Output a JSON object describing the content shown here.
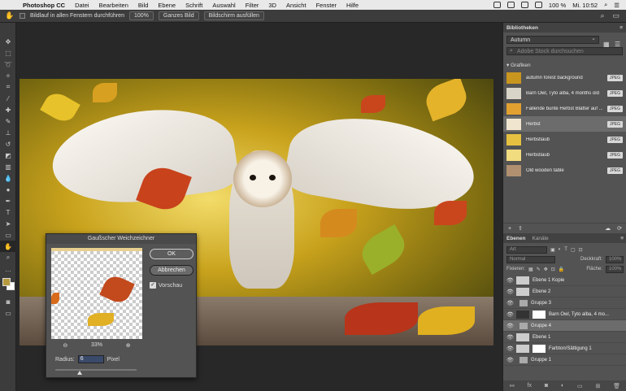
{
  "menubar": {
    "app": "Photoshop CC",
    "items": [
      "Datei",
      "Bearbeiten",
      "Bild",
      "Ebene",
      "Schrift",
      "Auswahl",
      "Filter",
      "3D",
      "Ansicht",
      "Fenster",
      "Hilfe"
    ],
    "battery": "100 %",
    "clock": "Mi. 10:52"
  },
  "options": {
    "scroll_all_label": "Bildlauf in allen Fenstern durchführen",
    "zoom100": "100%",
    "fit_screen": "Ganzes Bild",
    "fill_screen": "Bildschirm ausfüllen"
  },
  "dialog": {
    "title": "Gaußscher Weichzeichner",
    "ok": "OK",
    "cancel": "Abbrechen",
    "preview_label": "Vorschau",
    "zoom": "33%",
    "radius_label": "Radius:",
    "radius_value": "6",
    "radius_unit": "Pixel",
    "radius_fraction": 0.27
  },
  "libraries": {
    "tab": "Bibliotheken",
    "library": "Autumn",
    "search_placeholder": "Adobe Stock durchsuchen",
    "section": "Grafiken",
    "items": [
      {
        "name": "autumn forest background",
        "badge": "JPEG",
        "color": "#c8951e"
      },
      {
        "name": "Barn Owl, Tyto alba, 4 months old",
        "badge": "JPEG",
        "color": "#d9d4c8"
      },
      {
        "name": "Fallende bunte Herbst Blätter auf ...",
        "badge": "JPEG",
        "color": "#e2a030"
      },
      {
        "name": "Herbst",
        "badge": "JPEG",
        "color": "#f0e6d0"
      },
      {
        "name": "Herbstlaub",
        "badge": "JPEG",
        "color": "#e6c040"
      },
      {
        "name": "Herbstlaub",
        "badge": "JPEG",
        "color": "#f2dc80"
      },
      {
        "name": "Old wooden table",
        "badge": "JPEG",
        "color": "#b09070"
      }
    ]
  },
  "layers_panel": {
    "tab_layers": "Ebenen",
    "tab_channels": "Kanäle",
    "kind": "Art",
    "blend_mode": "Normal",
    "opacity_label": "Deckkraft:",
    "opacity_value": "100%",
    "lock_label": "Fixieren:",
    "fill_label": "Fläche:",
    "fill_value": "100%",
    "layers": [
      {
        "name": "Ebene 1 Kopie",
        "type": "layer"
      },
      {
        "name": "Ebene 2",
        "type": "layer"
      },
      {
        "name": "Gruppe 3",
        "type": "group"
      },
      {
        "name": "Barn Owl, Tyto alba, 4 mo...",
        "type": "masked"
      },
      {
        "name": "Gruppe 4",
        "type": "group"
      },
      {
        "name": "Ebene 1",
        "type": "layer"
      },
      {
        "name": "Farbton/Sättigung 1",
        "type": "adjust"
      },
      {
        "name": "Gruppe 1",
        "type": "group"
      }
    ]
  }
}
